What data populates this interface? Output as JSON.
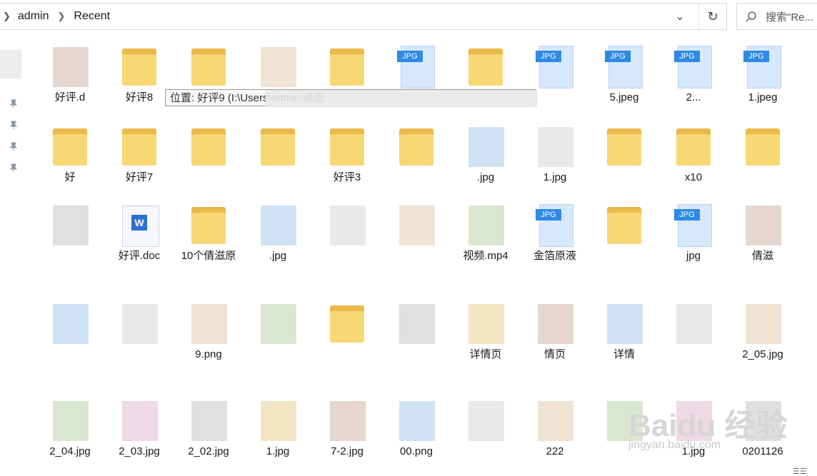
{
  "address": {
    "crumbs": [
      "admin",
      "Recent"
    ],
    "dropdown_icon": "chevron-down-icon",
    "refresh_icon": "refresh-icon"
  },
  "search": {
    "placeholder": "搜索\"Re..."
  },
  "tooltip": {
    "text": "位置: 好评9 (I:\\Users\\admin\\桌面"
  },
  "files": [
    {
      "type": "image",
      "label": "好评.d"
    },
    {
      "type": "folder",
      "label": "好评8"
    },
    {
      "type": "folder",
      "label": ""
    },
    {
      "type": "image",
      "label": ""
    },
    {
      "type": "folder",
      "label": ""
    },
    {
      "type": "jpg",
      "label": ""
    },
    {
      "type": "folder",
      "label": ""
    },
    {
      "type": "jpg",
      "label": ""
    },
    {
      "type": "jpg",
      "label": "5.jpeg"
    },
    {
      "type": "jpg",
      "label": "2..."
    },
    {
      "type": "jpg",
      "label": "1.jpeg"
    },
    {
      "type": "folder",
      "label": "好"
    },
    {
      "type": "folder",
      "label": "好评7"
    },
    {
      "type": "folder",
      "label": ""
    },
    {
      "type": "folder",
      "label": ""
    },
    {
      "type": "folder",
      "label": "好评3"
    },
    {
      "type": "folder",
      "label": ""
    },
    {
      "type": "image",
      "label": ".jpg"
    },
    {
      "type": "image",
      "label": "1.jpg"
    },
    {
      "type": "folder",
      "label": ""
    },
    {
      "type": "folder",
      "label": "x10"
    },
    {
      "type": "folder",
      "label": ""
    },
    {
      "type": "image",
      "label": ""
    },
    {
      "type": "doc",
      "label": "好评.doc"
    },
    {
      "type": "folder",
      "label": "10个倩滋原"
    },
    {
      "type": "image",
      "label": ".jpg"
    },
    {
      "type": "image",
      "label": ""
    },
    {
      "type": "image",
      "label": ""
    },
    {
      "type": "image",
      "label": "视频.mp4"
    },
    {
      "type": "jpg",
      "label": "金箔原液"
    },
    {
      "type": "folder",
      "label": ""
    },
    {
      "type": "jpg",
      "label": "jpg"
    },
    {
      "type": "image",
      "label": "倩滋"
    },
    {
      "type": "image",
      "label": ""
    },
    {
      "type": "image",
      "label": ""
    },
    {
      "type": "image",
      "label": "9.png"
    },
    {
      "type": "image",
      "label": ""
    },
    {
      "type": "folder",
      "label": ""
    },
    {
      "type": "image",
      "label": ""
    },
    {
      "type": "image",
      "label": "详情页"
    },
    {
      "type": "image",
      "label": "情页"
    },
    {
      "type": "image",
      "label": "详情"
    },
    {
      "type": "image",
      "label": ""
    },
    {
      "type": "image",
      "label": "2_05.jpg"
    },
    {
      "type": "image",
      "label": "2_04.jpg"
    },
    {
      "type": "image",
      "label": "2_03.jpg"
    },
    {
      "type": "image",
      "label": "2_02.jpg"
    },
    {
      "type": "image",
      "label": "1.jpg"
    },
    {
      "type": "image",
      "label": "7-2.jpg"
    },
    {
      "type": "image",
      "label": "00.png"
    },
    {
      "type": "image",
      "label": ""
    },
    {
      "type": "image",
      "label": "222"
    },
    {
      "type": "image",
      "label": ""
    },
    {
      "type": "image",
      "label": "1.jpg"
    },
    {
      "type": "image",
      "label": "0201126"
    }
  ],
  "watermark": {
    "text": "Baidu 经验",
    "url": "jingyan.baidu.com"
  },
  "colors": {
    "folder_back": "#e9b949",
    "folder_front": "#f8d775",
    "jpg_tag": "#2e8ae6"
  }
}
